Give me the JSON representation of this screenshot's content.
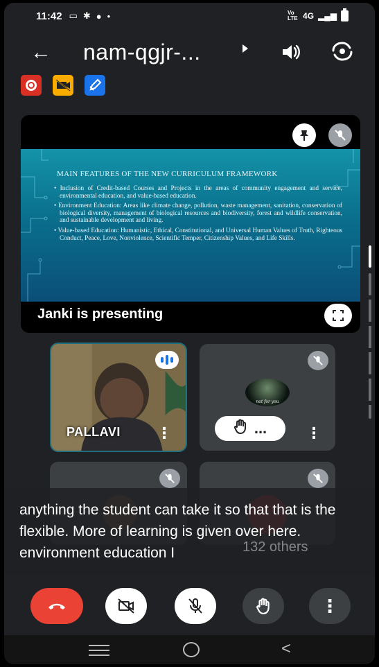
{
  "status_bar": {
    "time": "11:42",
    "network": "4G",
    "volte": "Vo LTE"
  },
  "header": {
    "title": "nam-qgjr-...",
    "icons": [
      "back-arrow-icon",
      "dropdown-arrow-icon",
      "speaker-icon",
      "switch-camera-icon"
    ]
  },
  "chips": [
    "record-icon",
    "no-video-icon",
    "edit-icon"
  ],
  "presentation": {
    "slide_title": "MAIN FEATURES OF THE NEW CURRICULUM FRAMEWORK",
    "bullets": [
      "Inclusion of Credit-based Courses and Projects in the areas of community engagement and service, environmental education, and value-based education.",
      "Environment Education: Areas like climate change, pollution, waste management, sanitation, conservation of biological diversity, management of biological resources and biodiversity, forest and wildlife conservation, and sustainable development and living.",
      "Value-based Education: Humanistic, Ethical, Constitutional, and Universal Human Values of Truth, Righteous Conduct, Peace, Love, Nonviolence, Scientific Temper, Citizenship Values, and Life Skills."
    ],
    "presenter_label": "Janki is presenting"
  },
  "participants": [
    {
      "name": "PALLAVI",
      "speaking": true
    },
    {
      "name": "",
      "muted": true,
      "hand_raised": true,
      "hand_label": "...",
      "avatar_caption": "not for you"
    },
    {
      "name": "",
      "muted": true
    },
    {
      "name": "",
      "muted": true
    }
  ],
  "captions": {
    "text": "anything the student can take it so that that is the flexible. More of learning is given over here. environment education I",
    "others": "132 others"
  },
  "controls": [
    "end-call-icon",
    "camera-off-icon",
    "mic-off-icon",
    "raise-hand-icon",
    "more-options-icon"
  ],
  "colors": {
    "background": "#202124",
    "end_call": "#ea4335",
    "record_chip": "#d93025",
    "effects_chip": "#f9ab00",
    "annotate_chip": "#1a73e8"
  }
}
